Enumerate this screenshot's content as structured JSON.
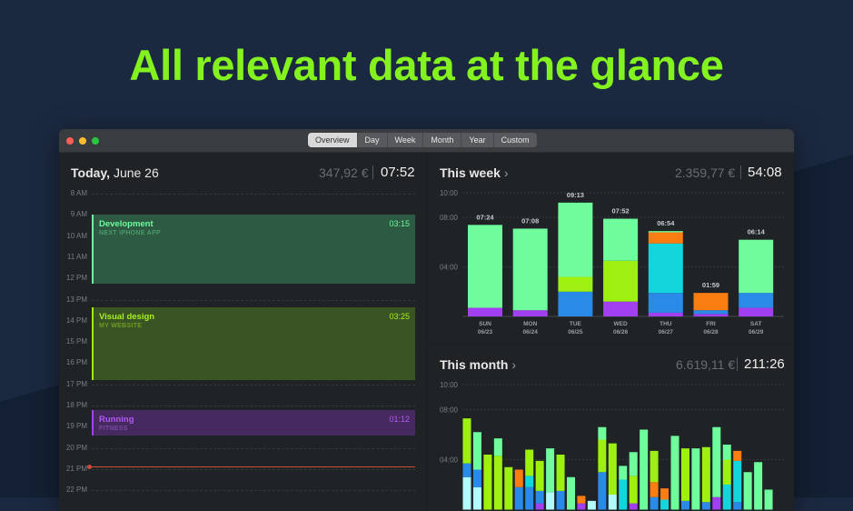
{
  "headline": "All relevant data at the glance",
  "colors": {
    "headline": "#84f21f",
    "mint": "#6efc9c",
    "lime": "#9ef011",
    "blue": "#2a8ae8",
    "purple": "#a23ff0",
    "orange": "#fa7d12",
    "cyan": "#12d6db",
    "now_line": "#d04a3a"
  },
  "window": {
    "tabs": [
      "Overview",
      "Day",
      "Week",
      "Month",
      "Year",
      "Custom"
    ],
    "active_tab": "Overview"
  },
  "today": {
    "title_bold": "Today,",
    "title_date": "June 26",
    "amount": "347,92 €",
    "time": "07:52",
    "hours": [
      "8 AM",
      "9 AM",
      "10 AM",
      "11 AM",
      "12 PM",
      "13 PM",
      "14 PM",
      "15 PM",
      "16 PM",
      "17 PM",
      "18 PM",
      "19 PM",
      "20 PM",
      "21 PM",
      "22 PM"
    ],
    "events": [
      {
        "title": "Development",
        "subtitle": "NEXT IPHONE APP",
        "duration": "03:15"
      },
      {
        "title": "Visual design",
        "subtitle": "MY WEBSITE",
        "duration": "03:25"
      },
      {
        "title": "Running",
        "subtitle": "FITNESS",
        "duration": "01:12"
      }
    ]
  },
  "week": {
    "title": "This week",
    "chevron": "›",
    "amount": "2.359,77 €",
    "time": "54:08",
    "y_ticks": [
      "10:00",
      "08:00",
      "04:00"
    ],
    "days": [
      {
        "label": "SUN",
        "date": "06/23",
        "total": "07:24"
      },
      {
        "label": "MON",
        "date": "06/24",
        "total": "07:08"
      },
      {
        "label": "TUE",
        "date": "06/25",
        "total": "09:13"
      },
      {
        "label": "WED",
        "date": "06/26",
        "total": "07:52"
      },
      {
        "label": "THU",
        "date": "06/27",
        "total": "06:54"
      },
      {
        "label": "FRI",
        "date": "06/28",
        "total": "01:59"
      },
      {
        "label": "SAT",
        "date": "06/29",
        "total": "06:14"
      }
    ]
  },
  "month": {
    "title": "This month",
    "chevron": "›",
    "amount": "6.619,11 €",
    "time": "211:26",
    "y_ticks": [
      "10:00",
      "08:00",
      "04:00"
    ]
  },
  "chart_data": [
    {
      "type": "bar",
      "stacked": true,
      "categories": [
        "SUN 06/23",
        "MON 06/24",
        "TUE 06/25",
        "WED 06/26",
        "THU 06/27",
        "FRI 06/28",
        "SAT 06/29"
      ],
      "ylim": [
        0,
        10
      ],
      "series": [
        {
          "color": "#a23ff0",
          "values": [
            0.7,
            0.5,
            0,
            1.2,
            0.3,
            0.2,
            0.7
          ]
        },
        {
          "color": "#2a8ae8",
          "values": [
            0,
            0,
            2.0,
            0,
            1.6,
            0.3,
            1.2
          ]
        },
        {
          "color": "#12d6db",
          "values": [
            0,
            0,
            0,
            0,
            4.0,
            0,
            0
          ]
        },
        {
          "color": "#9ef011",
          "values": [
            0,
            0,
            1.2,
            3.3,
            0,
            0,
            0
          ]
        },
        {
          "color": "#fa7d12",
          "values": [
            0,
            0,
            0,
            0,
            0.9,
            1.4,
            0
          ]
        },
        {
          "color": "#6efc9c",
          "values": [
            6.7,
            6.6,
            6.0,
            3.4,
            0.1,
            0,
            4.3
          ]
        }
      ]
    },
    {
      "type": "bar",
      "stacked": true,
      "ylim": [
        0,
        10
      ],
      "series_colors": [
        "#b2fbfd",
        "#2a8ae8",
        "#a23ff0",
        "#12d6db",
        "#fa7d12",
        "#9ef011",
        "#6efc9c"
      ],
      "bars": [
        [
          [
            0,
            2.6
          ],
          [
            1,
            1.1
          ],
          [
            5,
            3.6
          ]
        ],
        [
          [
            0,
            1.8
          ],
          [
            1,
            1.4
          ],
          [
            6,
            3.0
          ]
        ],
        [
          [
            5,
            4.4
          ]
        ],
        [
          [
            5,
            4.3
          ],
          [
            6,
            1.4
          ]
        ],
        [
          [
            5,
            3.4
          ]
        ],
        [
          [
            1,
            1.8
          ],
          [
            4,
            1.4
          ]
        ],
        [
          [
            1,
            1.8
          ],
          [
            3,
            0.9
          ],
          [
            5,
            2.1
          ]
        ],
        [
          [
            2,
            0.5
          ],
          [
            1,
            1.0
          ],
          [
            5,
            2.4
          ]
        ],
        [
          [
            0,
            1.4
          ],
          [
            6,
            3.5
          ]
        ],
        [
          [
            1,
            1.5
          ],
          [
            5,
            2.9
          ]
        ],
        [
          [
            6,
            2.6
          ]
        ],
        [
          [
            2,
            0.5
          ],
          [
            4,
            0.6
          ]
        ],
        [
          [
            0,
            0.7
          ]
        ],
        [
          [
            1,
            3.0
          ],
          [
            5,
            2.6
          ],
          [
            6,
            1.0
          ]
        ],
        [
          [
            0,
            1.2
          ],
          [
            5,
            4.1
          ]
        ],
        [
          [
            3,
            2.4
          ],
          [
            6,
            1.1
          ]
        ],
        [
          [
            2,
            0.5
          ],
          [
            5,
            2.2
          ],
          [
            6,
            1.9
          ]
        ],
        [
          [
            6,
            6.4
          ]
        ],
        [
          [
            1,
            1.0
          ],
          [
            4,
            1.2
          ],
          [
            5,
            2.5
          ]
        ],
        [
          [
            3,
            0.8
          ],
          [
            4,
            0.9
          ]
        ],
        [
          [
            6,
            5.9
          ]
        ],
        [
          [
            1,
            0.7
          ],
          [
            5,
            4.2
          ]
        ],
        [
          [
            6,
            4.9
          ]
        ],
        [
          [
            1,
            0.6
          ],
          [
            5,
            4.4
          ]
        ],
        [
          [
            2,
            1.0
          ],
          [
            6,
            5.6
          ]
        ],
        [
          [
            3,
            2.0
          ],
          [
            5,
            2.0
          ],
          [
            6,
            1.2
          ]
        ],
        [
          [
            1,
            0.6
          ],
          [
            3,
            3.3
          ],
          [
            4,
            0.8
          ]
        ],
        [
          [
            6,
            3.0
          ]
        ],
        [
          [
            6,
            3.8
          ]
        ],
        [
          [
            6,
            1.6
          ]
        ]
      ]
    }
  ]
}
